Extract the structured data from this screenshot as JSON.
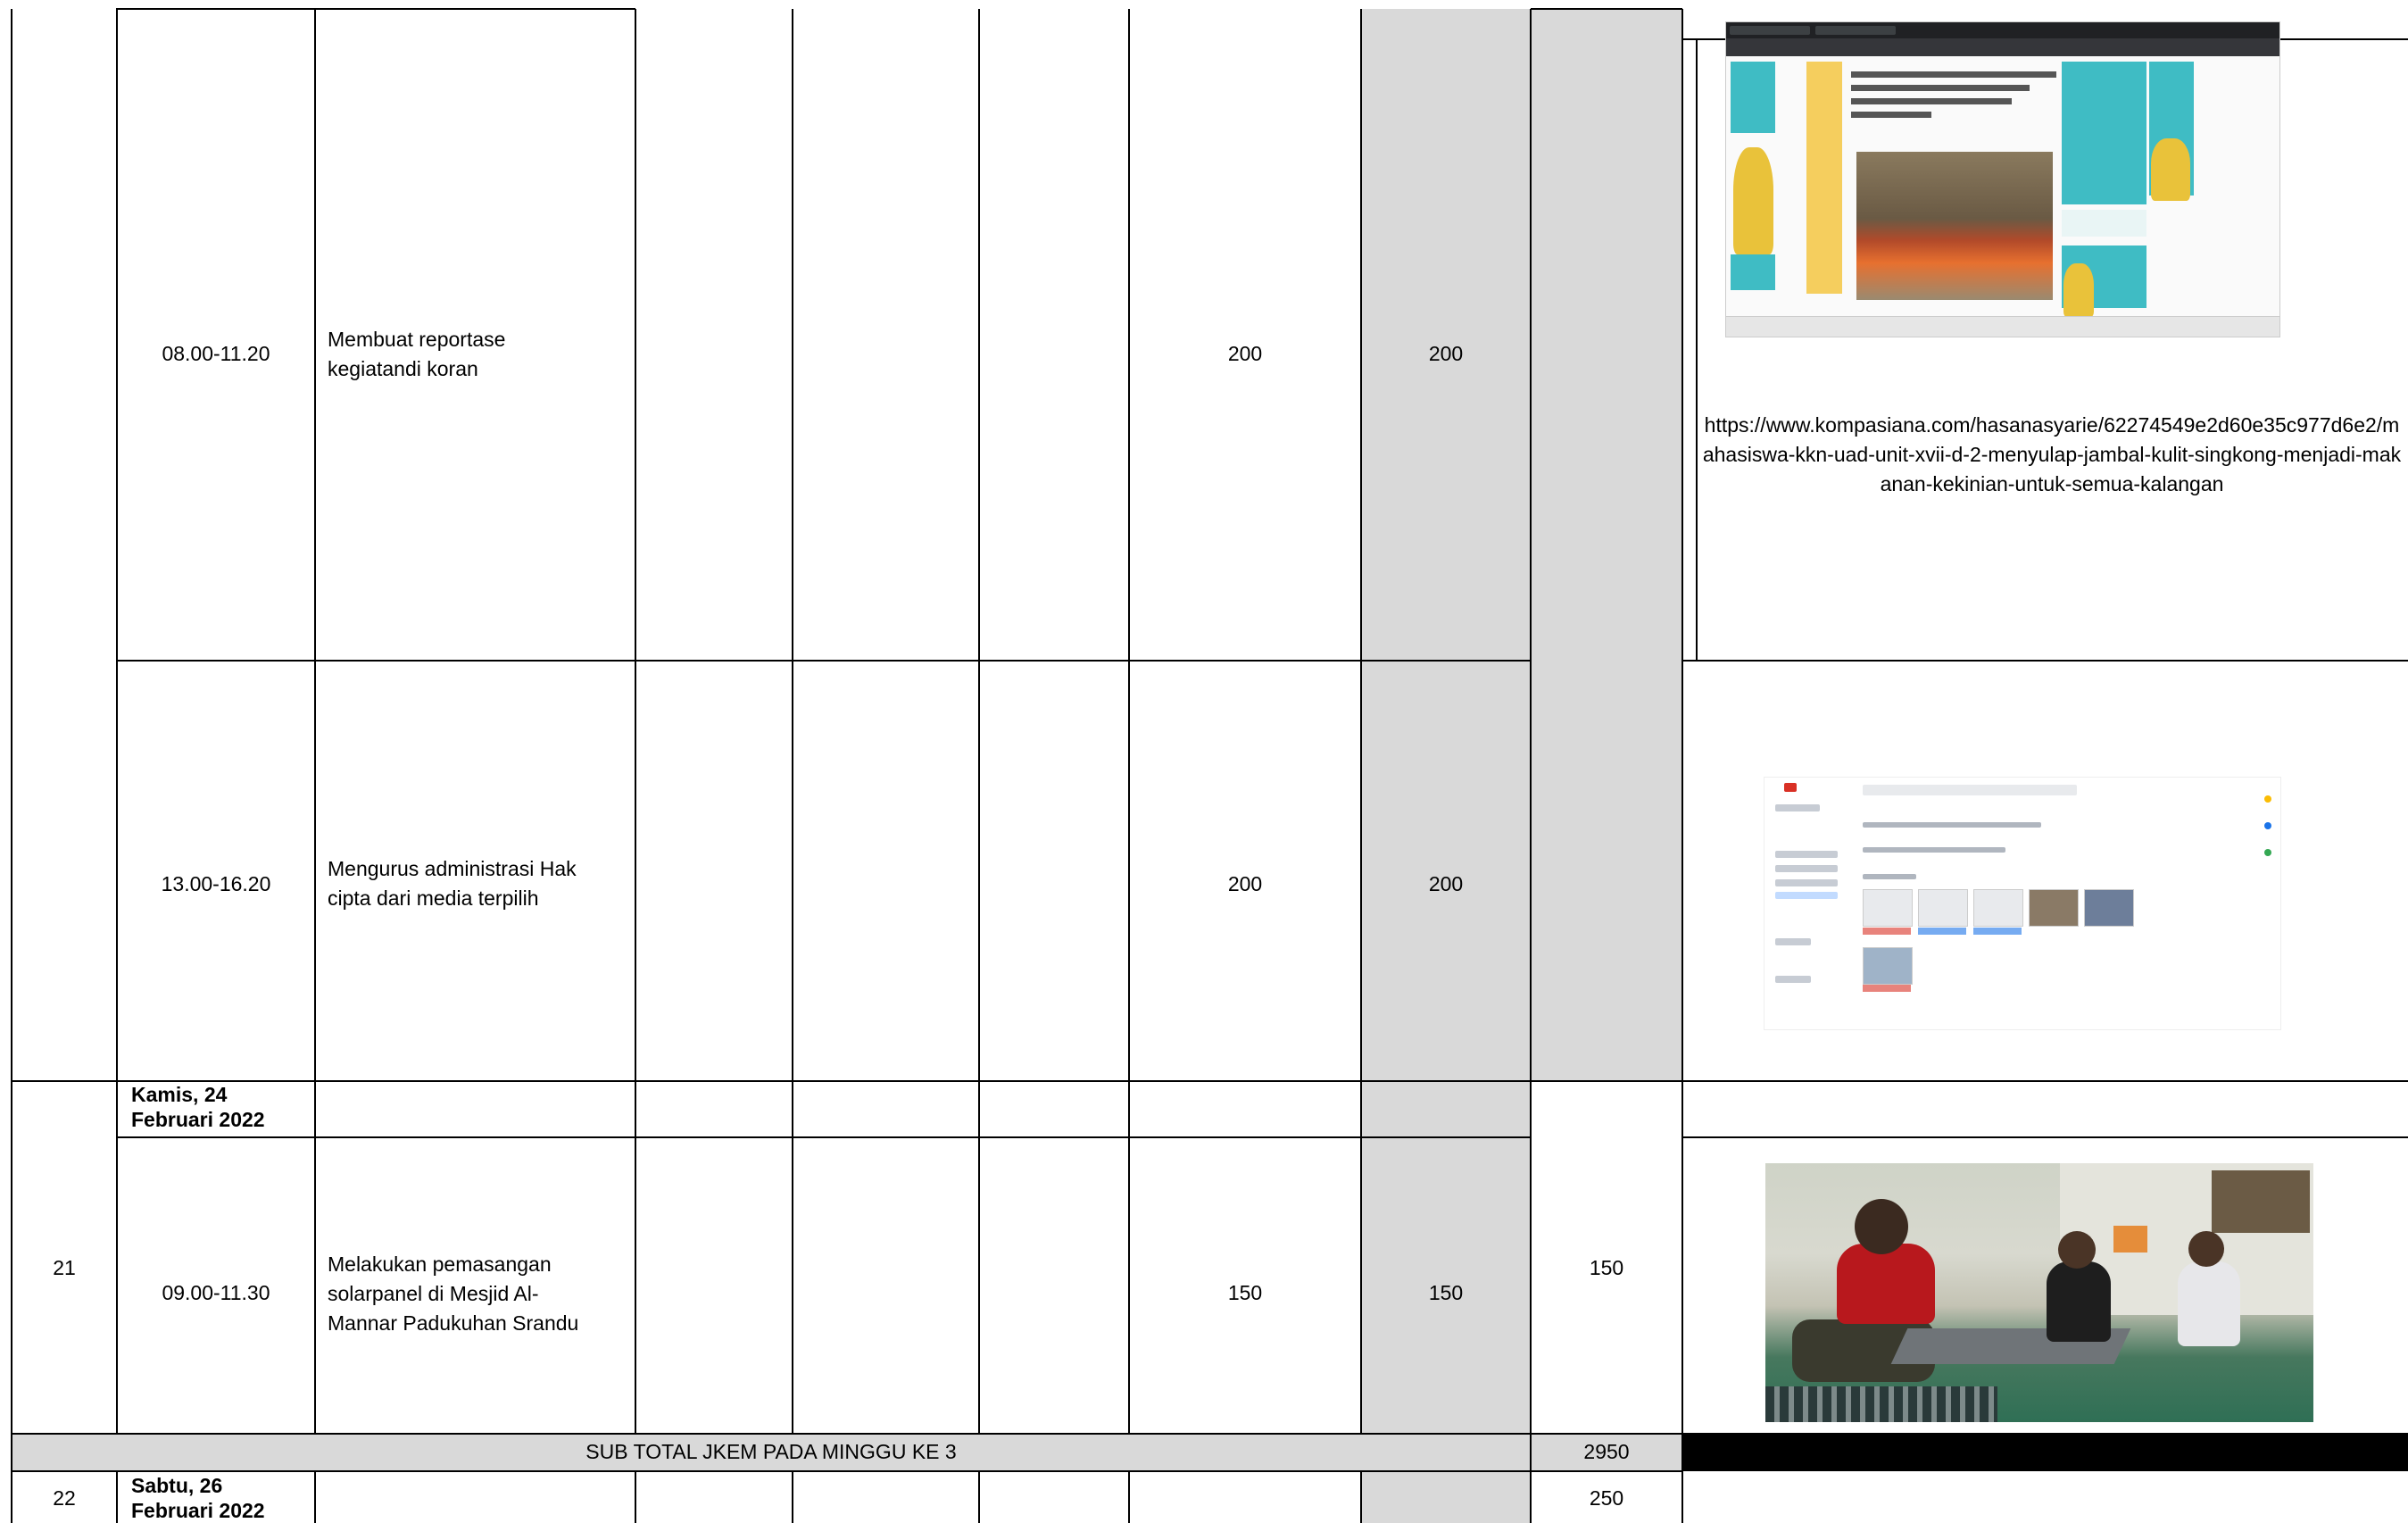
{
  "rows": [
    {
      "number": "",
      "date": "",
      "entries": [
        {
          "time": "08.00-11.20",
          "activity": "Membuat reportase kegiatandi koran",
          "jkem_1": "200",
          "jkem_2": "200",
          "evidence_type": "screenshot-news",
          "evidence_link": "https://www.kompasiana.com/hasanasyarie/62274549e2d60e35c977d6e2/mahasiswa-kkn-uad-unit-xvii-d-2-menyulap-jambal-kulit-singkong-menjadi-makanan-kekinian-untuk-semua-kalangan"
        },
        {
          "time": "13.00-16.20",
          "activity": "Mengurus administrasi Hak cipta dari media terpilih",
          "jkem_1": "200",
          "jkem_2": "200",
          "evidence_type": "screenshot-email"
        }
      ]
    },
    {
      "number": "21",
      "date": "Kamis, 24 Februari 2022",
      "day_total": "150",
      "entries": [
        {
          "time": "09.00-11.30",
          "activity": "Melakukan pemasangan solarpanel di Mesjid Al-Mannar Padukuhan Srandu",
          "jkem_1": "150",
          "jkem_2": "150",
          "evidence_type": "photo"
        }
      ]
    }
  ],
  "subtotal": {
    "label": "SUB TOTAL JKEM PADA MINGGU KE 3",
    "value": "2950"
  },
  "next_row": {
    "number": "22",
    "date": "Sabtu, 26 Februari 2022",
    "day_total": "250"
  },
  "colors": {
    "shaded_cell": "#d9d9d9",
    "border": "#000000"
  }
}
